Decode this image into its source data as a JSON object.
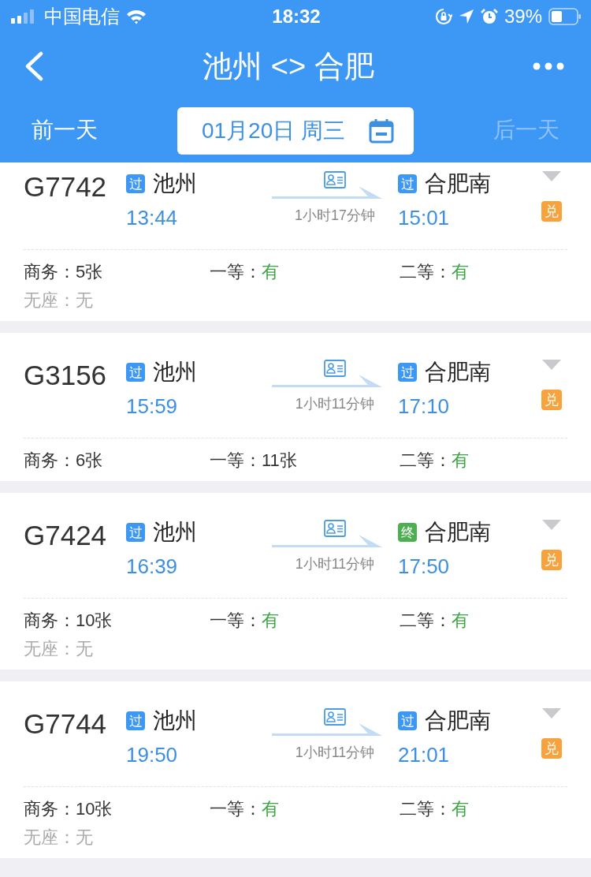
{
  "status_bar": {
    "carrier": "中国电信",
    "time": "18:32",
    "battery": "39%"
  },
  "nav": {
    "title": "池州 <> 合肥",
    "prev_day": {
      "label": "前一天",
      "disabled": false
    },
    "date": "01月20日 周三",
    "next_day": {
      "label": "后一天",
      "disabled": true
    }
  },
  "trains": [
    {
      "number": "G7742",
      "from": {
        "badge": "过",
        "kind": "pass",
        "station": "池州",
        "time": "13:44"
      },
      "duration": "1小时17分钟",
      "to": {
        "badge": "过",
        "kind": "pass",
        "station": "合肥南",
        "time": "15:01"
      },
      "exchange": "兑",
      "seats": [
        {
          "label": "商务：",
          "value": "5张",
          "kind": "count"
        },
        {
          "label": "一等：",
          "value": "有",
          "kind": "available"
        },
        {
          "label": "二等：",
          "value": "有",
          "kind": "available"
        },
        {
          "label": "无座：",
          "value": "无",
          "kind": "none"
        }
      ]
    },
    {
      "number": "G3156",
      "from": {
        "badge": "过",
        "kind": "pass",
        "station": "池州",
        "time": "15:59"
      },
      "duration": "1小时11分钟",
      "to": {
        "badge": "过",
        "kind": "pass",
        "station": "合肥南",
        "time": "17:10"
      },
      "exchange": "兑",
      "seats": [
        {
          "label": "商务：",
          "value": "6张",
          "kind": "count"
        },
        {
          "label": "一等：",
          "value": "11张",
          "kind": "count"
        },
        {
          "label": "二等：",
          "value": "有",
          "kind": "available"
        }
      ]
    },
    {
      "number": "G7424",
      "from": {
        "badge": "过",
        "kind": "pass",
        "station": "池州",
        "time": "16:39"
      },
      "duration": "1小时11分钟",
      "to": {
        "badge": "终",
        "kind": "terminal",
        "station": "合肥南",
        "time": "17:50"
      },
      "exchange": "兑",
      "seats": [
        {
          "label": "商务：",
          "value": "10张",
          "kind": "count"
        },
        {
          "label": "一等：",
          "value": "有",
          "kind": "available"
        },
        {
          "label": "二等：",
          "value": "有",
          "kind": "available"
        },
        {
          "label": "无座：",
          "value": "无",
          "kind": "none"
        }
      ]
    },
    {
      "number": "G7744",
      "from": {
        "badge": "过",
        "kind": "pass",
        "station": "池州",
        "time": "19:50"
      },
      "duration": "1小时11分钟",
      "to": {
        "badge": "过",
        "kind": "pass",
        "station": "合肥南",
        "time": "21:01"
      },
      "exchange": "兑",
      "seats": [
        {
          "label": "商务：",
          "value": "10张",
          "kind": "count"
        },
        {
          "label": "一等：",
          "value": "有",
          "kind": "available"
        },
        {
          "label": "二等：",
          "value": "有",
          "kind": "available"
        },
        {
          "label": "无座：",
          "value": "无",
          "kind": "none"
        }
      ]
    }
  ]
}
